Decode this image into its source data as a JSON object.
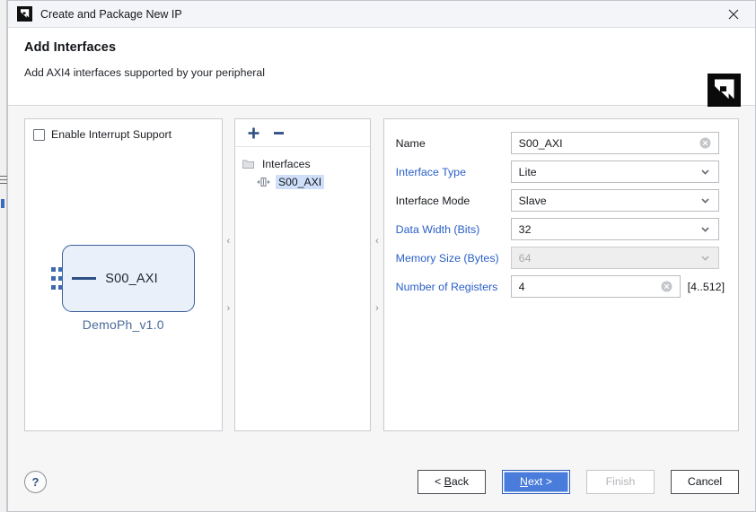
{
  "window": {
    "title": "Create and Package New IP",
    "icon": "xilinx-logo-icon",
    "close_label": "✕"
  },
  "header": {
    "title": "Add Interfaces",
    "subtitle": "Add AXI4 interfaces supported by your peripheral",
    "logo": "amd-xilinx-logo-icon"
  },
  "diagram_panel": {
    "interrupt_checkbox": {
      "label": "Enable Interrupt Support",
      "checked": false
    },
    "ip_block": {
      "port_label": "S00_AXI",
      "caption": "DemoPh_v1.0"
    }
  },
  "splitters": {
    "collapse_left": "‹",
    "expand_right": "›"
  },
  "tree_panel": {
    "toolbar": {
      "add_label": "+",
      "remove_label": "−"
    },
    "nodes": [
      {
        "label": "Interfaces",
        "icon": "folder-icon",
        "selected": false
      },
      {
        "label": "S00_AXI",
        "icon": "interface-bus-icon",
        "selected": true
      }
    ]
  },
  "form_panel": {
    "fields": [
      {
        "label": "Name",
        "label_color": "black",
        "value": "S00_AXI",
        "type": "text",
        "disabled": false,
        "clearable": true,
        "width": "wide"
      },
      {
        "label": "Interface Type",
        "label_color": "blue",
        "value": "Lite",
        "type": "select",
        "disabled": false,
        "clearable": false,
        "width": "wide"
      },
      {
        "label": "Interface Mode",
        "label_color": "black",
        "value": "Slave",
        "type": "select",
        "disabled": false,
        "clearable": false,
        "width": "wide"
      },
      {
        "label": "Data Width (Bits)",
        "label_color": "blue",
        "value": "32",
        "type": "select",
        "disabled": false,
        "clearable": false,
        "width": "wide"
      },
      {
        "label": "Memory Size (Bytes)",
        "label_color": "blue",
        "value": "64",
        "type": "select",
        "disabled": true,
        "clearable": false,
        "width": "wide"
      },
      {
        "label": "Number of Registers",
        "label_color": "blue",
        "value": "4",
        "type": "text",
        "disabled": false,
        "clearable": true,
        "width": "narrow",
        "hint": "[4..512]"
      }
    ]
  },
  "footer": {
    "help_label": "?",
    "buttons": [
      {
        "name": "back",
        "label": "< Back",
        "accel": "B",
        "style": "normal"
      },
      {
        "name": "next",
        "label": "Next >",
        "accel": "N",
        "style": "primary"
      },
      {
        "name": "finish",
        "label": "Finish",
        "accel": "",
        "style": "disabled"
      },
      {
        "name": "cancel",
        "label": "Cancel",
        "accel": "",
        "style": "normal"
      }
    ]
  },
  "colors": {
    "accent_blue": "#2a5fc9",
    "primary_button": "#4a7ddb",
    "selection": "#cfdffa",
    "block_fill": "#eaf0fa",
    "block_border": "#3a5f99"
  }
}
